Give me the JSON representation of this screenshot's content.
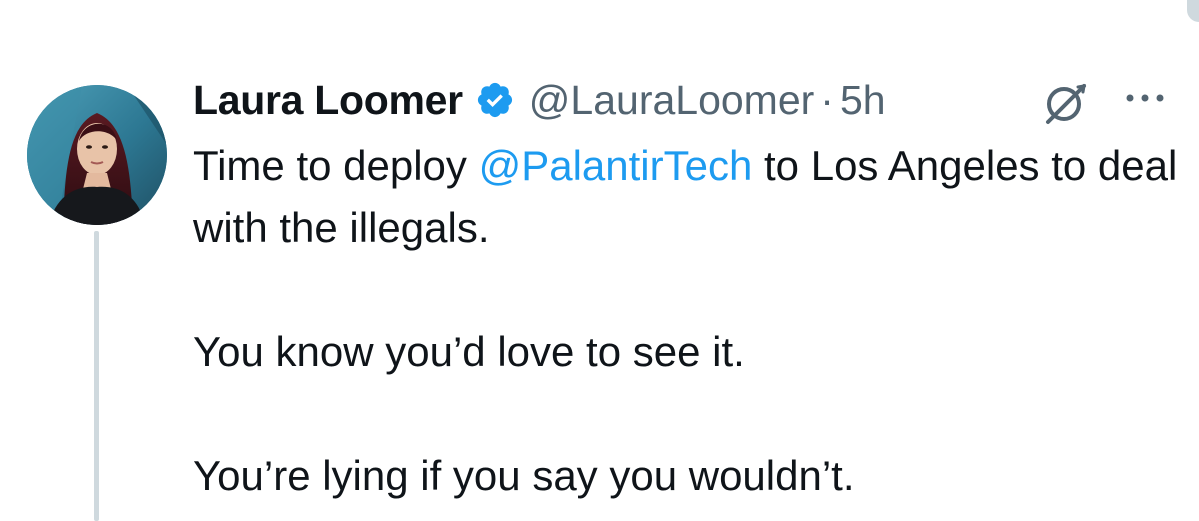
{
  "tweet": {
    "display_name": "Laura Loomer",
    "handle": "@LauraLoomer",
    "separator": "·",
    "time": "5h",
    "line1_before": "Time to deploy ",
    "mention": "@PalantirTech",
    "line1_after": " to Los Angeles to deal with the illegals.",
    "paragraph2": "You know you’d love to see it.",
    "paragraph3": "You’re lying if you say you wouldn’t."
  },
  "icons": {
    "verified": "verified-badge-icon",
    "grok": "grok-icon",
    "more": "more-icon"
  },
  "colors": {
    "text": "#0f1419",
    "muted": "#536471",
    "link": "#1d9bf0",
    "verified": "#1d9bf0",
    "thread_line": "#cfd9de"
  }
}
